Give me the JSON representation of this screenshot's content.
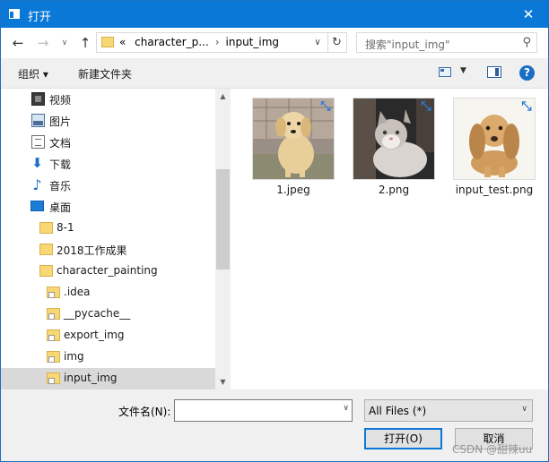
{
  "window": {
    "title": "打开",
    "close_label": "✕"
  },
  "nav": {
    "back_glyph": "←",
    "forward_glyph": "→",
    "recent_glyph": "∨",
    "up_glyph": "↑",
    "breadcrumb_prefix": "«",
    "breadcrumbs": [
      "character_p...",
      "input_img"
    ],
    "breadcrumb_sep": "›",
    "refresh_glyph": "↻",
    "dropdown_glyph": "∨",
    "search_placeholder": "搜索\"input_img\"",
    "search_glyph": "⚲"
  },
  "toolbar": {
    "organize_label": "组织 ▾",
    "new_folder_label": "新建文件夹",
    "view_dropdown_glyph": "▼",
    "help_label": "?"
  },
  "tree": [
    {
      "label": "视频",
      "icon": "video-icon"
    },
    {
      "label": "图片",
      "icon": "picture-icon"
    },
    {
      "label": "文档",
      "icon": "document-icon"
    },
    {
      "label": "下载",
      "icon": "download-icon"
    },
    {
      "label": "音乐",
      "icon": "music-icon"
    },
    {
      "label": "桌面",
      "icon": "desktop-icon"
    },
    {
      "label": "8-1",
      "icon": "folder-icon"
    },
    {
      "label": "2018工作成果",
      "icon": "folder-icon"
    },
    {
      "label": "character_painting",
      "icon": "folder-icon"
    },
    {
      "label": ".idea",
      "icon": "folder-icon"
    },
    {
      "label": "__pycache__",
      "icon": "folder-icon"
    },
    {
      "label": "export_img",
      "icon": "folder-icon"
    },
    {
      "label": "img",
      "icon": "folder-icon"
    },
    {
      "label": "input_img",
      "icon": "folder-icon",
      "selected": true
    }
  ],
  "tree_glyphs": {
    "download": "⬇",
    "music": "♪",
    "scroll_up": "▲",
    "scroll_down": "▼"
  },
  "files": [
    {
      "name": "1.jpeg",
      "thumbnail": "puppy-photo"
    },
    {
      "name": "2.png",
      "thumbnail": "cat-photo"
    },
    {
      "name": "input_test.png",
      "thumbnail": "dog-photo"
    }
  ],
  "badge_glyph": "⤡",
  "footer": {
    "filename_label": "文件名(N):",
    "filename_value": "",
    "filename_dropdown_glyph": "∨",
    "filter_value": "All Files  (*)",
    "filter_dropdown_glyph": "∨",
    "open_label": "打开(O)",
    "cancel_label": "取消",
    "watermark": "CSDN @甜辣uu"
  },
  "colors": {
    "titlebar": "#0a78d7",
    "accent": "#1a6ec6",
    "folder": "#f8d775",
    "selected_row": "#d9d9d9"
  }
}
